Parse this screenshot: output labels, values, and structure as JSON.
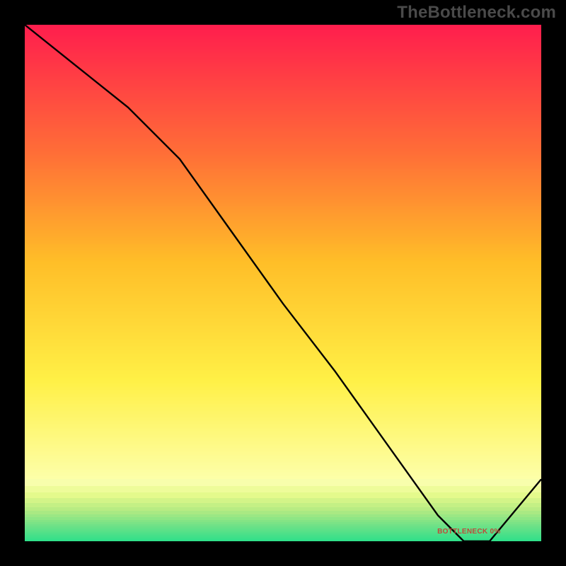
{
  "watermark": "TheBottleneck.com",
  "chart_data": {
    "type": "line",
    "x": [
      0.0,
      0.1,
      0.2,
      0.3,
      0.4,
      0.5,
      0.6,
      0.7,
      0.8,
      0.85,
      0.9,
      1.0
    ],
    "y": [
      1.0,
      0.92,
      0.84,
      0.74,
      0.6,
      0.46,
      0.33,
      0.19,
      0.05,
      0.0,
      0.0,
      0.12
    ],
    "title": "",
    "xlabel": "",
    "ylabel": "",
    "xlim": [
      0,
      1
    ],
    "ylim": [
      0,
      1
    ],
    "minimum_region": {
      "x_start": 0.82,
      "x_end": 0.9,
      "y": 0.0
    },
    "annotations": [
      {
        "text": "BOTTLENECK 0%",
        "x": 0.86,
        "y": 0.01
      }
    ],
    "background": {
      "type": "vertical-gradient-bands",
      "description": "red at top through orange and yellow to pale-yellow, then thin narrowing horizontal bands toward green at the very bottom",
      "stops": [
        {
          "y": 1.0,
          "color": "#ff1a4d"
        },
        {
          "y": 0.75,
          "color": "#ff7a2e"
        },
        {
          "y": 0.5,
          "color": "#ffc81a"
        },
        {
          "y": 0.25,
          "color": "#fff44a"
        },
        {
          "y": 0.1,
          "color": "#fdff9e"
        },
        {
          "y": 0.0,
          "color": "#2ee08a"
        }
      ]
    }
  }
}
